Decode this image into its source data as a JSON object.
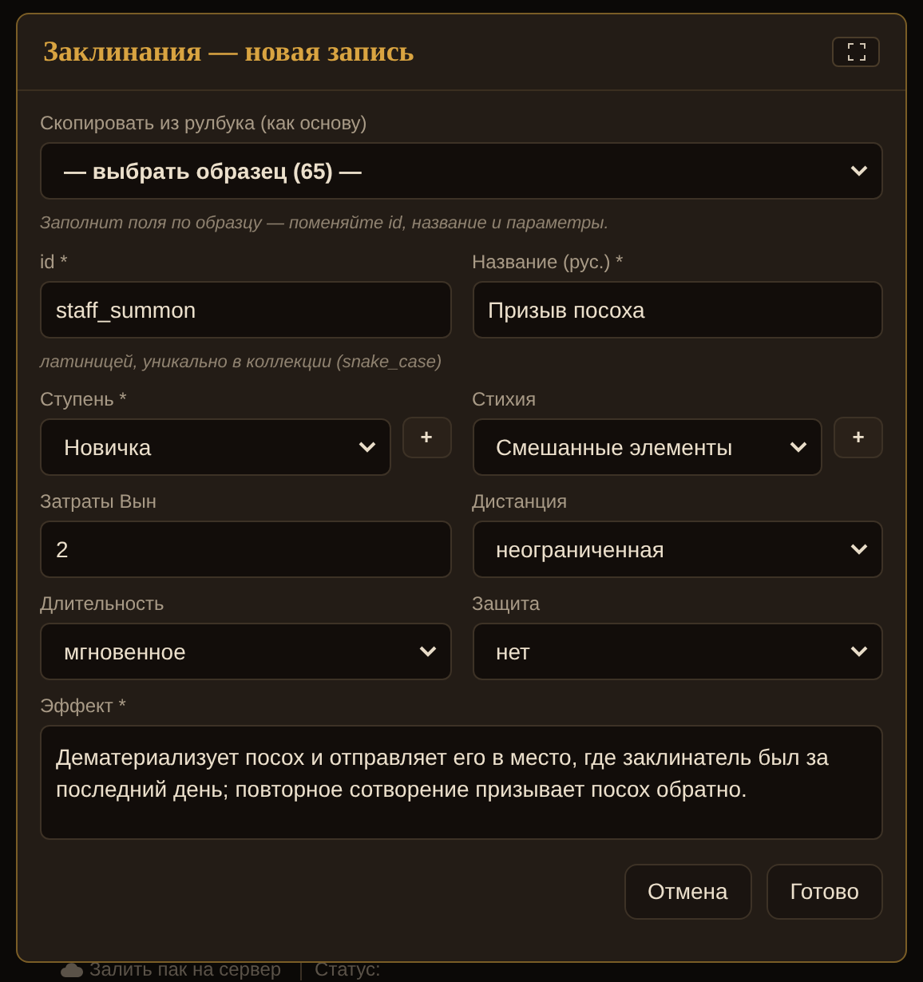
{
  "background": {
    "upload_button": "Залить пак на сервер",
    "status_label": "Статус:"
  },
  "dialog": {
    "title": "Заклинания — новая запись",
    "template": {
      "label": "Скопировать из рулбука (как основу)",
      "value": "— выбрать образец (65) —",
      "hint": "Заполнит поля по образцу — поменяйте id, название и параметры."
    },
    "fields": [
      {
        "kind": "input",
        "label": "id *",
        "value": "staff_summon",
        "hint": "латиницей, уникально в коллекции (snake_case)"
      },
      {
        "kind": "input",
        "label": "Название (рус.) *",
        "value": "Призыв посоха"
      },
      {
        "kind": "select",
        "label": "Ступень *",
        "value": "Новичка",
        "add_button": "+"
      },
      {
        "kind": "select",
        "label": "Стихия",
        "value": "Смешанные элементы",
        "add_button": "+"
      },
      {
        "kind": "input",
        "label": "Затраты Вын",
        "value": "2"
      },
      {
        "kind": "select",
        "label": "Дистанция",
        "value": "неограниченная"
      },
      {
        "kind": "select",
        "label": "Длительность",
        "value": "мгновенное"
      },
      {
        "kind": "select",
        "label": "Защита",
        "value": "нет"
      }
    ],
    "effect": {
      "label": "Эффект *",
      "value": "Дематериализует посох и отправляет его в место, где заклинатель был за последний день; повторное сотворение призывает посох обратно."
    },
    "buttons": [
      "Отмена",
      "Готово"
    ]
  }
}
